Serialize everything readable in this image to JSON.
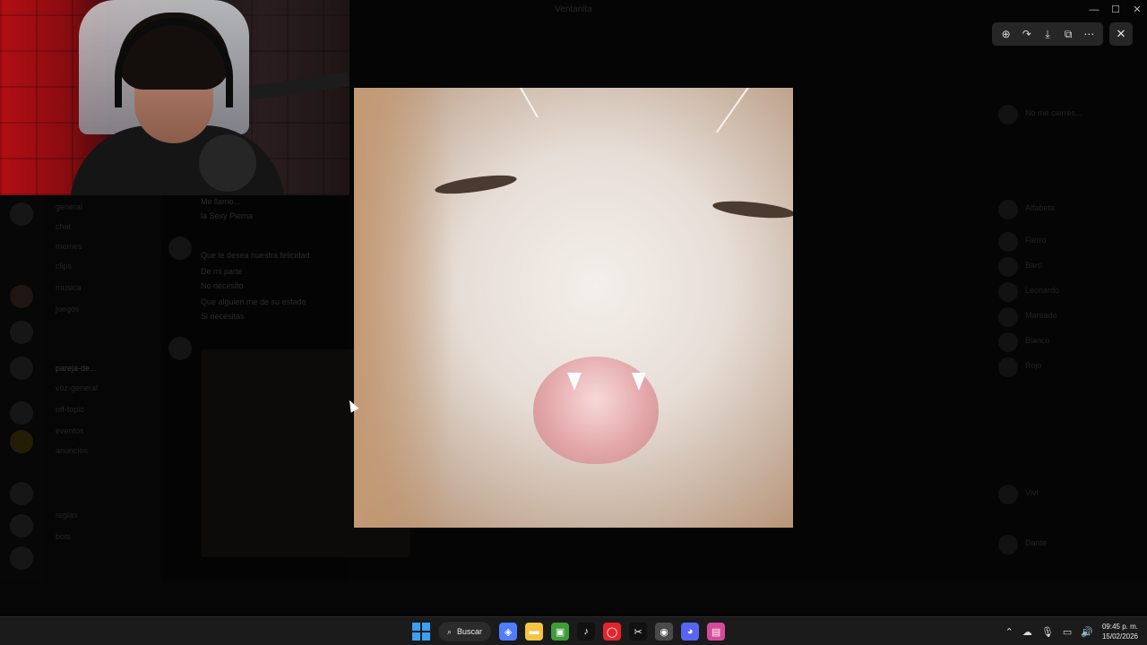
{
  "window": {
    "title": "Ventanita",
    "minimize": "—",
    "maximize": "☐",
    "close": "✕"
  },
  "viewer_toolbar": {
    "zoom": "⊕",
    "rotate": "↷",
    "download": "⤓",
    "open_external": "⧉",
    "more": "⋯",
    "close": "✕"
  },
  "channels": [
    "general",
    "chat",
    "memes",
    "clips",
    "musica",
    "juegos",
    "pareja-de...",
    "voz-general",
    "off-topic",
    "eventos",
    "anuncios",
    "reglas",
    "bots"
  ],
  "chat_messages": [
    "Me llamo...",
    "la Sexy Pierna",
    "Que le desea nuestra felicidad",
    "De mi parte",
    "No necesito",
    "Que alguien me de su estado",
    "Si necesitas"
  ],
  "members": [
    "No me cierres...",
    "Alfabeta",
    "Fierro",
    "Baro",
    "Leonardo",
    "Mareado",
    "Blanco",
    "Rojo",
    "Vivi",
    "Dante"
  ],
  "taskbar": {
    "search_label": "Buscar",
    "search_icon": "⌕",
    "apps": [
      {
        "name": "copilot",
        "glyph": "◈",
        "color": "#4f7dff"
      },
      {
        "name": "file-explorer",
        "glyph": "▬",
        "color": "#f4c443"
      },
      {
        "name": "minecraft",
        "glyph": "▣",
        "color": "#3e9c3a"
      },
      {
        "name": "tiktok",
        "glyph": "♪",
        "color": "#111111"
      },
      {
        "name": "opera",
        "glyph": "◯",
        "color": "#e2242f"
      },
      {
        "name": "capcut",
        "glyph": "✂",
        "color": "#111111"
      },
      {
        "name": "chrome",
        "glyph": "◉",
        "color": "#4a4a4a"
      },
      {
        "name": "discord",
        "glyph": "◕",
        "color": "#5865f2"
      },
      {
        "name": "editor",
        "glyph": "▤",
        "color": "#d64a9b"
      }
    ],
    "tray": {
      "chevron": "⌃",
      "cloud": "☁",
      "mic": "🎙",
      "network": "▭",
      "volume": "🔊"
    },
    "clock_time": "09:45 p. m.",
    "clock_date": "15/02/2026"
  }
}
